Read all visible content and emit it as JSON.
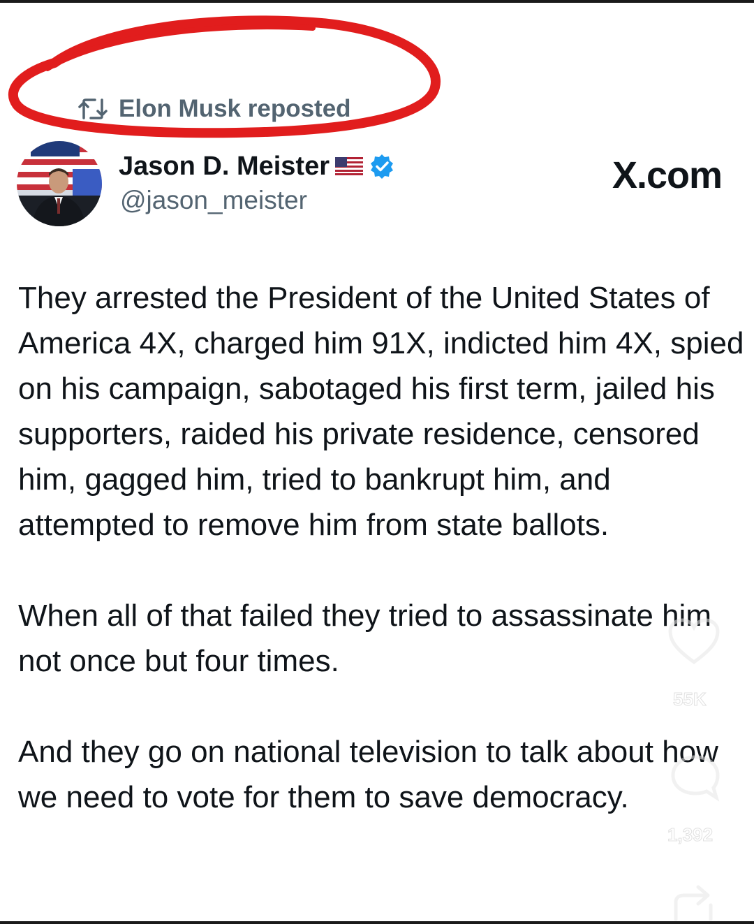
{
  "repost": {
    "text": "Elon Musk reposted",
    "icon": "repost-icon"
  },
  "author": {
    "display_name": "Jason D. Meister",
    "handle": "@jason_meister",
    "flag_icon": "us-flag-icon",
    "verified_icon": "verified-badge-icon",
    "avatar_icon": "avatar"
  },
  "site_label": "X.com",
  "post": {
    "paragraphs": [
      "They arrested the President of the United States of America 4X, charged him 91X, indicted him 4X, spied on his campaign, sabotaged his first term, jailed his supporters, raided his private residence, censored him, gagged him, tried to bankrupt him, and attempted to remove him from state ballots.",
      "When all of that failed they tried to assassinate him not once but four times.",
      "And they go on national television to talk about how we need to vote for them to save democracy."
    ]
  },
  "overlay": {
    "likes": "55K",
    "comments": "1,392",
    "like_icon": "heart-icon",
    "comment_icon": "comment-icon",
    "share_icon": "share-icon"
  },
  "colors": {
    "annotation_red": "#e11d1d",
    "text": "#0f1419",
    "secondary_text": "#536471",
    "verified_blue": "#1d9bf0"
  }
}
